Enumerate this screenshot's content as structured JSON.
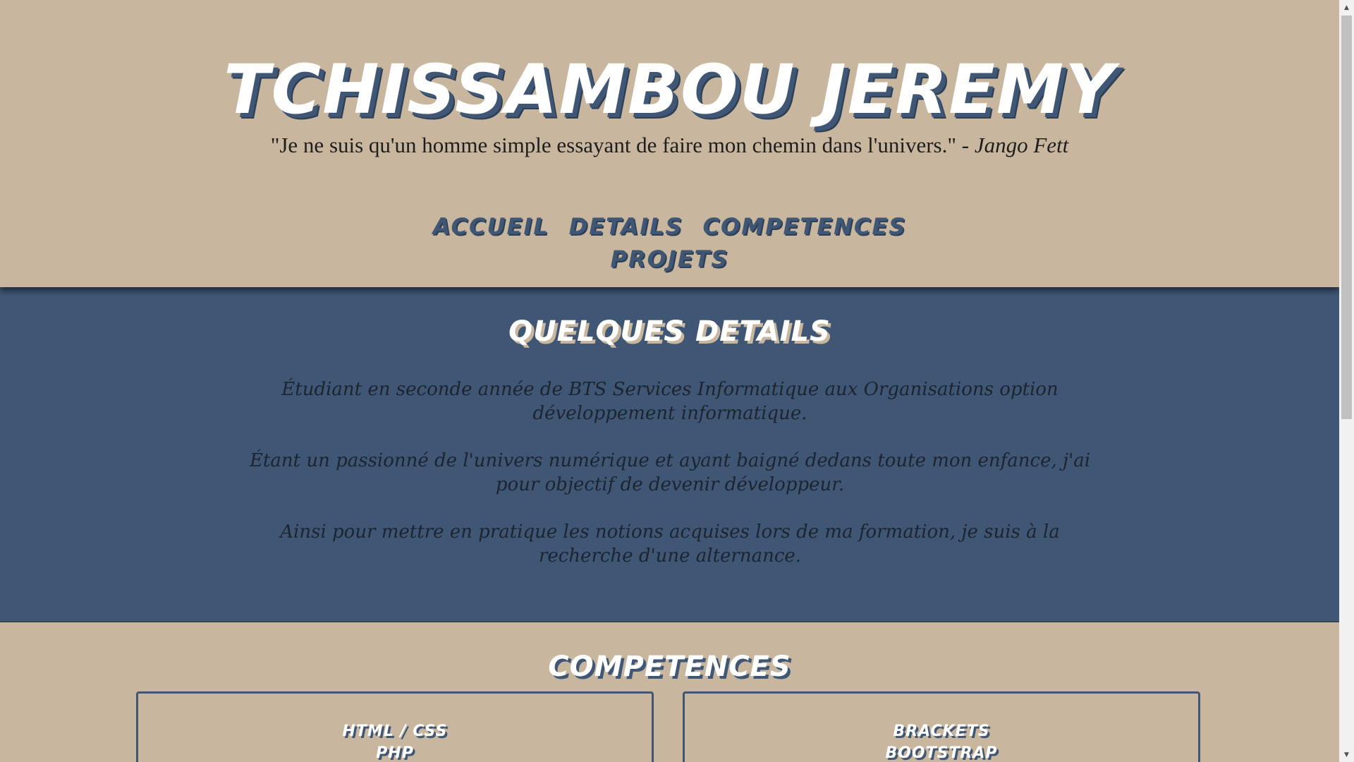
{
  "header": {
    "title": "TCHISSAMBOU JEREMY",
    "quote_text": "\"Je ne suis qu'un homme simple essayant de faire mon chemin dans l'univers.\" - ",
    "quote_author": "Jango Fett"
  },
  "nav": {
    "items": [
      {
        "label": "ACCUEIL"
      },
      {
        "label": "DETAILS"
      },
      {
        "label": "COMPETENCES"
      },
      {
        "label": "PROJETS"
      }
    ]
  },
  "details": {
    "title": "QUELQUES DETAILS",
    "paragraphs": [
      "Étudiant en seconde année de BTS Services Informatique aux Organisations option développement informatique.",
      "Étant un passionné de l'univers numérique et ayant baigné dedans toute mon enfance, j'ai pour objectif de devenir développeur.",
      "Ainsi pour mettre en pratique les notions acquises lors de ma formation, je suis à la recherche d'une alternance."
    ]
  },
  "competences": {
    "title": "COMPETENCES",
    "cards": [
      {
        "items": [
          "HTML / CSS",
          "PHP"
        ]
      },
      {
        "items": [
          "BRACKETS",
          "BOOTSTRAP"
        ]
      }
    ]
  },
  "colors": {
    "beige": "#c8b79e",
    "navy": "#3f5775",
    "white": "#ffffff"
  }
}
